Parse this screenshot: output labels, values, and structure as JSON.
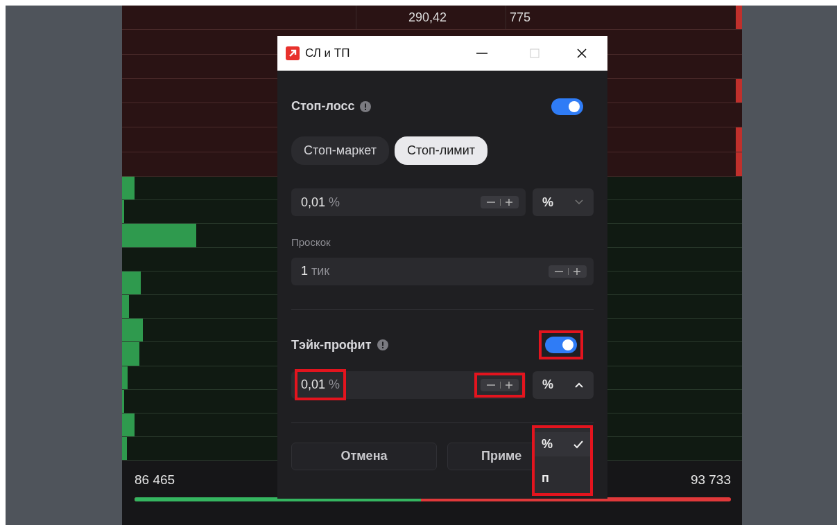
{
  "order_book": {
    "asks": [
      {
        "price": "290,42",
        "volume": "775",
        "level": 0.01
      },
      {
        "level": 0
      },
      {
        "level": 0
      },
      {
        "level": 0.01
      },
      {
        "level": 0
      },
      {
        "level": 0.01
      },
      {
        "level": 0.01
      }
    ],
    "bids": [
      {
        "level": 0.02
      },
      {
        "level": 0.003
      },
      {
        "level": 0.12
      },
      {
        "level": 0
      },
      {
        "level": 0.03
      },
      {
        "level": 0.011
      },
      {
        "level": 0.033
      },
      {
        "level": 0.028
      },
      {
        "level": 0.009
      },
      {
        "level": 0.003
      },
      {
        "level": 0.02
      },
      {
        "level": 0.008
      }
    ],
    "bid_total": "86 465",
    "ask_total": "93 733",
    "balance": {
      "level": 0.48
    }
  },
  "dialog": {
    "title": "СЛ и ТП",
    "stop_loss": {
      "label": "Стоп-лосс",
      "on": true,
      "types": [
        {
          "label": "Стоп-маркет",
          "selected": false
        },
        {
          "label": "Стоп-лимит",
          "selected": true
        }
      ],
      "value": "0,01",
      "value_unit": "%",
      "unit": "%",
      "unit_open": false,
      "slippage_label": "Проскок",
      "slippage_value": "1",
      "slippage_unit": "тик"
    },
    "take_profit": {
      "label": "Тэйк-профит",
      "on": true,
      "highlighted": true,
      "value": "0,01",
      "value_unit": "%",
      "value_highlighted": true,
      "stepper_highlighted": true,
      "unit": "%",
      "unit_open": true,
      "menu": {
        "highlighted": true,
        "items": [
          {
            "label": "%",
            "selected": true
          },
          {
            "label": "п",
            "selected": false
          }
        ]
      }
    },
    "buttons": [
      {
        "label": "Отмена",
        "kind": "secondary"
      },
      {
        "label": "Приме",
        "kind": "primary"
      }
    ]
  }
}
